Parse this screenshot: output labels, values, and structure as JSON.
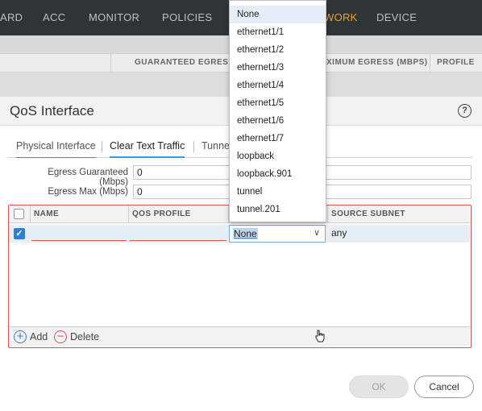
{
  "topnav": {
    "items": [
      "ARD",
      "ACC",
      "MONITOR",
      "POLICIES",
      "WORK",
      "DEVICE"
    ],
    "active": "WORK"
  },
  "background_table": {
    "columns": [
      "GUARANTEED EGRESS",
      "XIMUM EGRESS (MBPS)",
      "PROFILE"
    ]
  },
  "dialog": {
    "title": "QoS Interface",
    "help": "?",
    "tabs": [
      "Physical Interface",
      "Clear Text Traffic",
      "Tunnel"
    ],
    "egress_guaranteed": {
      "label": "Egress Guaranteed (Mbps)",
      "value": "0"
    },
    "egress_max": {
      "label": "Egress Max (Mbps)",
      "value": "0"
    },
    "grid": {
      "columns": [
        "NAME",
        "QOS PROFILE",
        "",
        "SOURCE SUBNET"
      ],
      "row": {
        "name": "",
        "qos_profile": "",
        "source_interface": "None",
        "source_subnet": "any"
      }
    },
    "footer": {
      "add": "Add",
      "delete": "Delete"
    },
    "buttons": {
      "ok": "OK",
      "cancel": "Cancel"
    }
  },
  "dropdown": {
    "options": [
      "None",
      "ethernet1/1",
      "ethernet1/2",
      "ethernet1/3",
      "ethernet1/4",
      "ethernet1/5",
      "ethernet1/6",
      "ethernet1/7",
      "loopback",
      "loopback.901",
      "tunnel",
      "tunnel.201"
    ],
    "selected": "None"
  },
  "colors": {
    "nav_bg": "#2f3438",
    "nav_active": "#e8a23a",
    "error_border": "#d9534f",
    "accent_blue": "#2d7fd3"
  }
}
